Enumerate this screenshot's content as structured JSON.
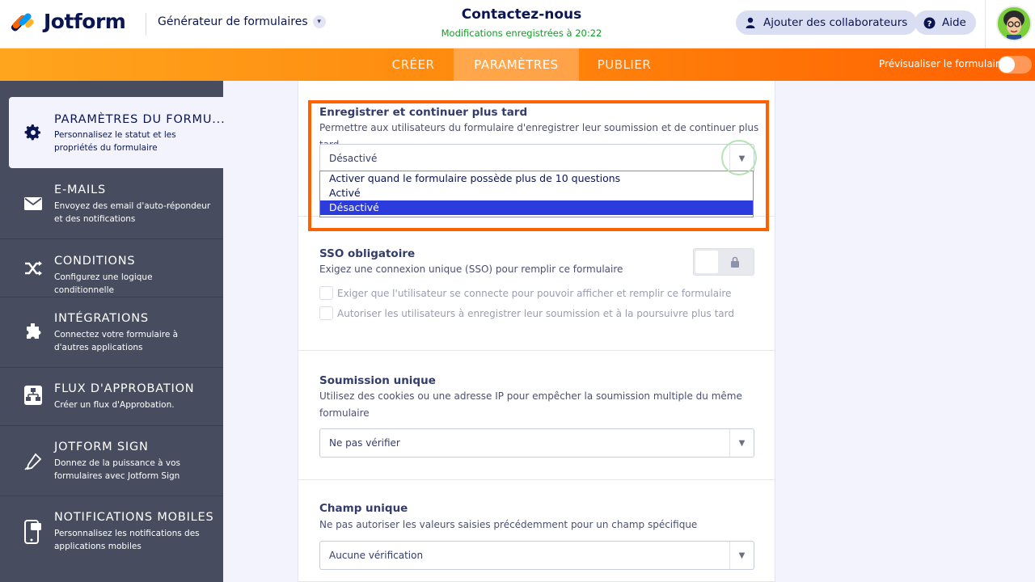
{
  "app": {
    "logo_text": "Jotform",
    "builder_label": "Générateur de formulaires",
    "form_title": "Contactez-nous",
    "saved_status": "Modifications enregistrées à 20:22",
    "add_collaborators": "Ajouter des collaborateurs",
    "help": "Aide"
  },
  "nav": {
    "tabs": [
      {
        "label": "CRÉER"
      },
      {
        "label": "PARAMÈTRES"
      },
      {
        "label": "PUBLIER"
      }
    ],
    "preview_label": "Prévisualiser le formulaire"
  },
  "sidebar": {
    "items": [
      {
        "title": "PARAMÈTRES DU FORMU...",
        "desc": "Personnalisez le statut et les propriétés du formulaire",
        "icon": "gear-icon"
      },
      {
        "title": "E-MAILS",
        "desc": "Envoyez des email d'auto-répondeur et des notifications",
        "icon": "envelope-icon"
      },
      {
        "title": "CONDITIONS",
        "desc": "Configurez une logique conditionnelle",
        "icon": "shuffle-icon"
      },
      {
        "title": "INTÉGRATIONS",
        "desc": "Connectez votre formulaire à d'autres applications",
        "icon": "puzzle-icon"
      },
      {
        "title": "FLUX D'APPROBATION",
        "desc": "Créer un flux d'Approbation.",
        "icon": "flow-icon"
      },
      {
        "title": "JOTFORM SIGN",
        "desc": "Donnez de la puissance à vos formulaires avec Jotform Sign",
        "icon": "pen-icon"
      },
      {
        "title": "NOTIFICATIONS MOBILES",
        "desc": "Personnalisez les notifications des applications mobiles",
        "icon": "mobile-icon"
      }
    ]
  },
  "save_continue": {
    "title": "Enregistrer et continuer plus tard",
    "desc": "Permettre aux utilisateurs du formulaire d'enregistrer leur soumission et de continuer plus tard",
    "value": "Désactivé",
    "options": [
      "Activer quand le formulaire possède plus de 10 questions",
      "Activé",
      "Désactivé"
    ]
  },
  "sso": {
    "title": "SSO obligatoire",
    "desc": "Exigez une connexion unique (SSO) pour remplir ce formulaire",
    "check1": "Exiger que l'utilisateur se connecte pour pouvoir afficher et remplir ce formulaire",
    "check2": "Autoriser les utilisateurs à enregistrer leur soumission et à la poursuivre plus tard"
  },
  "unique_submission": {
    "title": "Soumission unique",
    "desc_line1": "Utilisez des cookies ou une adresse IP pour empêcher la soumission multiple du même",
    "desc_line2": "formulaire",
    "value": "Ne pas vérifier"
  },
  "unique_field": {
    "title": "Champ unique",
    "desc": "Ne pas autoriser les valeurs saisies précédemment pour un champ spécifique",
    "value": "Aucune vérification"
  },
  "colors": {
    "accent_orange": "#ff6100",
    "sidebar_bg": "#484c5f",
    "selected_option": "#2b3bdc",
    "saved_green": "#0f9d24"
  }
}
